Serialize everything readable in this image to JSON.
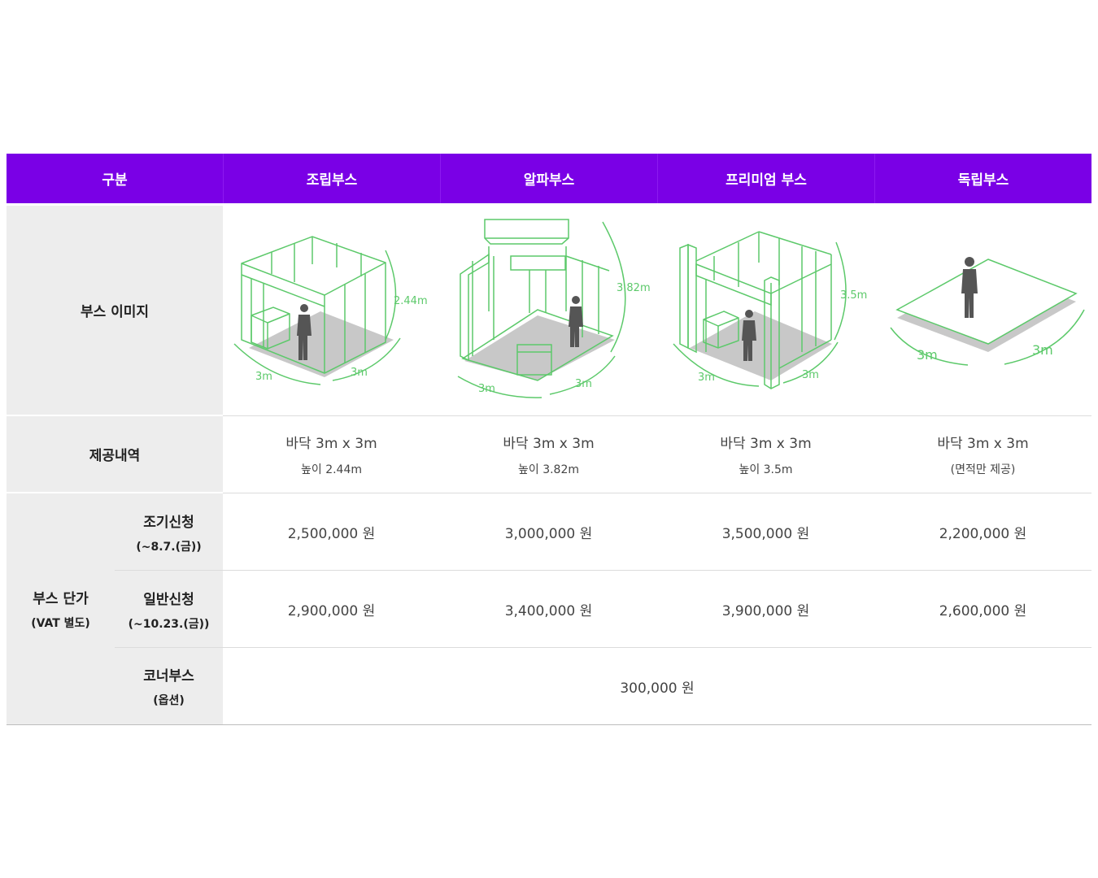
{
  "header": {
    "col0": "구분",
    "col1": "조립부스",
    "col2": "알파부스",
    "col3": "프리미엄 부스",
    "col4": "독립부스"
  },
  "rows": {
    "image_label": "부스 이미지",
    "provision_label": "제공내역",
    "price_label": "부스 단가",
    "price_label_sub": "(VAT 별도)",
    "early_label": "조기신청",
    "early_sub": "(~8.7.(금))",
    "general_label": "일반신청",
    "general_sub": "(~10.23.(금))",
    "corner_label": "코너부스",
    "corner_sub": "(옵션)"
  },
  "booths": [
    {
      "floor": "바닥 3m x 3m",
      "note": "높이 2.44m",
      "early": "2,500,000 원",
      "general": "2,900,000 원",
      "dims": {
        "w": "3m",
        "d": "3m",
        "h": "2.44m"
      }
    },
    {
      "floor": "바닥 3m x 3m",
      "note": "높이 3.82m",
      "early": "3,000,000 원",
      "general": "3,400,000 원",
      "dims": {
        "w": "3m",
        "d": "3m",
        "h": "3.82m"
      }
    },
    {
      "floor": "바닥 3m x 3m",
      "note": "높이 3.5m",
      "early": "3,500,000 원",
      "general": "3,900,000 원",
      "dims": {
        "w": "3m",
        "d": "3m",
        "h": "3.5m"
      }
    },
    {
      "floor": "바닥 3m x 3m",
      "note": "(면적만 제공)",
      "early": "2,200,000 원",
      "general": "2,600,000 원",
      "dims": {
        "w": "3m",
        "d": "3m"
      }
    }
  ],
  "corner_price": "300,000 원",
  "colors": {
    "header_bg": "#7a00e6",
    "line_green": "#5cc96a",
    "label_bg": "#ededed"
  }
}
